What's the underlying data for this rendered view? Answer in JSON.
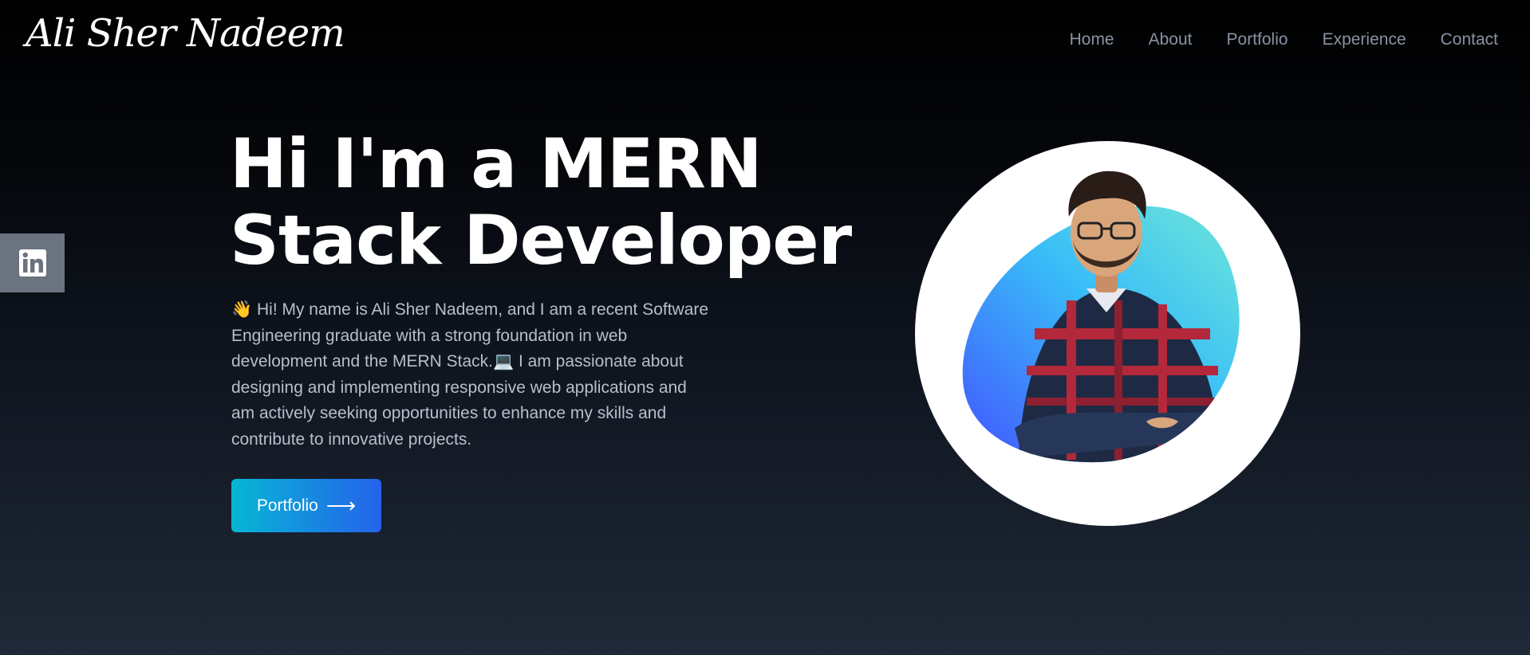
{
  "header": {
    "logo_text": "Ali Sher Nadeem",
    "nav": [
      {
        "label": "Home"
      },
      {
        "label": "About"
      },
      {
        "label": "Portfolio"
      },
      {
        "label": "Experience"
      },
      {
        "label": "Contact"
      }
    ]
  },
  "social": {
    "icon": "linkedin-icon",
    "color": "#6b7280"
  },
  "hero": {
    "title_line1": "Hi I'm a MERN",
    "title_line2": "Stack Developer",
    "description": "👋 Hi! My name is Ali Sher Nadeem, and I am a recent Software Engineering graduate with a strong foundation in web development and the MERN Stack.💻  I am passionate about designing and implementing responsive web applications and am actively seeking opportunities to enhance my skills and contribute to innovative projects.",
    "button_label": "Portfolio",
    "button_icon": "arrow-right-icon",
    "button_colors": [
      "#06b6d4",
      "#2563eb"
    ],
    "avatar_blob_colors": [
      "#4353ff",
      "#38bdf8",
      "#6ee7d8"
    ]
  }
}
